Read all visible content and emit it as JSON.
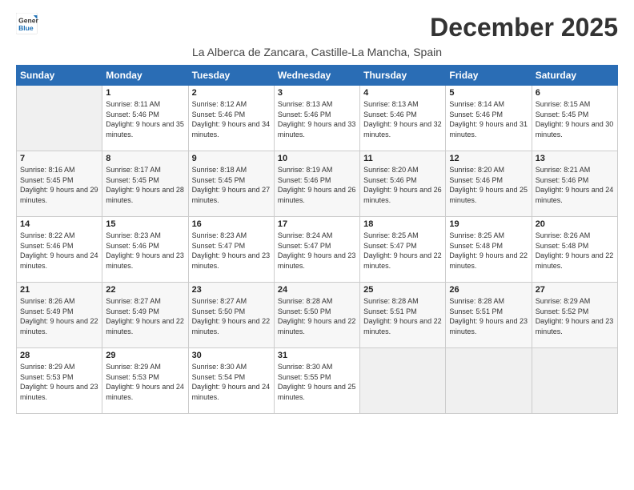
{
  "logo": {
    "line1": "General",
    "line2": "Blue"
  },
  "title": "December 2025",
  "subtitle": "La Alberca de Zancara, Castille-La Mancha, Spain",
  "days_of_week": [
    "Sunday",
    "Monday",
    "Tuesday",
    "Wednesday",
    "Thursday",
    "Friday",
    "Saturday"
  ],
  "weeks": [
    [
      {
        "day": "",
        "sunrise": "",
        "sunset": "",
        "daylight": ""
      },
      {
        "day": "1",
        "sunrise": "Sunrise: 8:11 AM",
        "sunset": "Sunset: 5:46 PM",
        "daylight": "Daylight: 9 hours and 35 minutes."
      },
      {
        "day": "2",
        "sunrise": "Sunrise: 8:12 AM",
        "sunset": "Sunset: 5:46 PM",
        "daylight": "Daylight: 9 hours and 34 minutes."
      },
      {
        "day": "3",
        "sunrise": "Sunrise: 8:13 AM",
        "sunset": "Sunset: 5:46 PM",
        "daylight": "Daylight: 9 hours and 33 minutes."
      },
      {
        "day": "4",
        "sunrise": "Sunrise: 8:13 AM",
        "sunset": "Sunset: 5:46 PM",
        "daylight": "Daylight: 9 hours and 32 minutes."
      },
      {
        "day": "5",
        "sunrise": "Sunrise: 8:14 AM",
        "sunset": "Sunset: 5:46 PM",
        "daylight": "Daylight: 9 hours and 31 minutes."
      },
      {
        "day": "6",
        "sunrise": "Sunrise: 8:15 AM",
        "sunset": "Sunset: 5:45 PM",
        "daylight": "Daylight: 9 hours and 30 minutes."
      }
    ],
    [
      {
        "day": "7",
        "sunrise": "Sunrise: 8:16 AM",
        "sunset": "Sunset: 5:45 PM",
        "daylight": "Daylight: 9 hours and 29 minutes."
      },
      {
        "day": "8",
        "sunrise": "Sunrise: 8:17 AM",
        "sunset": "Sunset: 5:45 PM",
        "daylight": "Daylight: 9 hours and 28 minutes."
      },
      {
        "day": "9",
        "sunrise": "Sunrise: 8:18 AM",
        "sunset": "Sunset: 5:45 PM",
        "daylight": "Daylight: 9 hours and 27 minutes."
      },
      {
        "day": "10",
        "sunrise": "Sunrise: 8:19 AM",
        "sunset": "Sunset: 5:46 PM",
        "daylight": "Daylight: 9 hours and 26 minutes."
      },
      {
        "day": "11",
        "sunrise": "Sunrise: 8:20 AM",
        "sunset": "Sunset: 5:46 PM",
        "daylight": "Daylight: 9 hours and 26 minutes."
      },
      {
        "day": "12",
        "sunrise": "Sunrise: 8:20 AM",
        "sunset": "Sunset: 5:46 PM",
        "daylight": "Daylight: 9 hours and 25 minutes."
      },
      {
        "day": "13",
        "sunrise": "Sunrise: 8:21 AM",
        "sunset": "Sunset: 5:46 PM",
        "daylight": "Daylight: 9 hours and 24 minutes."
      }
    ],
    [
      {
        "day": "14",
        "sunrise": "Sunrise: 8:22 AM",
        "sunset": "Sunset: 5:46 PM",
        "daylight": "Daylight: 9 hours and 24 minutes."
      },
      {
        "day": "15",
        "sunrise": "Sunrise: 8:23 AM",
        "sunset": "Sunset: 5:46 PM",
        "daylight": "Daylight: 9 hours and 23 minutes."
      },
      {
        "day": "16",
        "sunrise": "Sunrise: 8:23 AM",
        "sunset": "Sunset: 5:47 PM",
        "daylight": "Daylight: 9 hours and 23 minutes."
      },
      {
        "day": "17",
        "sunrise": "Sunrise: 8:24 AM",
        "sunset": "Sunset: 5:47 PM",
        "daylight": "Daylight: 9 hours and 23 minutes."
      },
      {
        "day": "18",
        "sunrise": "Sunrise: 8:25 AM",
        "sunset": "Sunset: 5:47 PM",
        "daylight": "Daylight: 9 hours and 22 minutes."
      },
      {
        "day": "19",
        "sunrise": "Sunrise: 8:25 AM",
        "sunset": "Sunset: 5:48 PM",
        "daylight": "Daylight: 9 hours and 22 minutes."
      },
      {
        "day": "20",
        "sunrise": "Sunrise: 8:26 AM",
        "sunset": "Sunset: 5:48 PM",
        "daylight": "Daylight: 9 hours and 22 minutes."
      }
    ],
    [
      {
        "day": "21",
        "sunrise": "Sunrise: 8:26 AM",
        "sunset": "Sunset: 5:49 PM",
        "daylight": "Daylight: 9 hours and 22 minutes."
      },
      {
        "day": "22",
        "sunrise": "Sunrise: 8:27 AM",
        "sunset": "Sunset: 5:49 PM",
        "daylight": "Daylight: 9 hours and 22 minutes."
      },
      {
        "day": "23",
        "sunrise": "Sunrise: 8:27 AM",
        "sunset": "Sunset: 5:50 PM",
        "daylight": "Daylight: 9 hours and 22 minutes."
      },
      {
        "day": "24",
        "sunrise": "Sunrise: 8:28 AM",
        "sunset": "Sunset: 5:50 PM",
        "daylight": "Daylight: 9 hours and 22 minutes."
      },
      {
        "day": "25",
        "sunrise": "Sunrise: 8:28 AM",
        "sunset": "Sunset: 5:51 PM",
        "daylight": "Daylight: 9 hours and 22 minutes."
      },
      {
        "day": "26",
        "sunrise": "Sunrise: 8:28 AM",
        "sunset": "Sunset: 5:51 PM",
        "daylight": "Daylight: 9 hours and 23 minutes."
      },
      {
        "day": "27",
        "sunrise": "Sunrise: 8:29 AM",
        "sunset": "Sunset: 5:52 PM",
        "daylight": "Daylight: 9 hours and 23 minutes."
      }
    ],
    [
      {
        "day": "28",
        "sunrise": "Sunrise: 8:29 AM",
        "sunset": "Sunset: 5:53 PM",
        "daylight": "Daylight: 9 hours and 23 minutes."
      },
      {
        "day": "29",
        "sunrise": "Sunrise: 8:29 AM",
        "sunset": "Sunset: 5:53 PM",
        "daylight": "Daylight: 9 hours and 24 minutes."
      },
      {
        "day": "30",
        "sunrise": "Sunrise: 8:30 AM",
        "sunset": "Sunset: 5:54 PM",
        "daylight": "Daylight: 9 hours and 24 minutes."
      },
      {
        "day": "31",
        "sunrise": "Sunrise: 8:30 AM",
        "sunset": "Sunset: 5:55 PM",
        "daylight": "Daylight: 9 hours and 25 minutes."
      },
      {
        "day": "",
        "sunrise": "",
        "sunset": "",
        "daylight": ""
      },
      {
        "day": "",
        "sunrise": "",
        "sunset": "",
        "daylight": ""
      },
      {
        "day": "",
        "sunrise": "",
        "sunset": "",
        "daylight": ""
      }
    ]
  ]
}
